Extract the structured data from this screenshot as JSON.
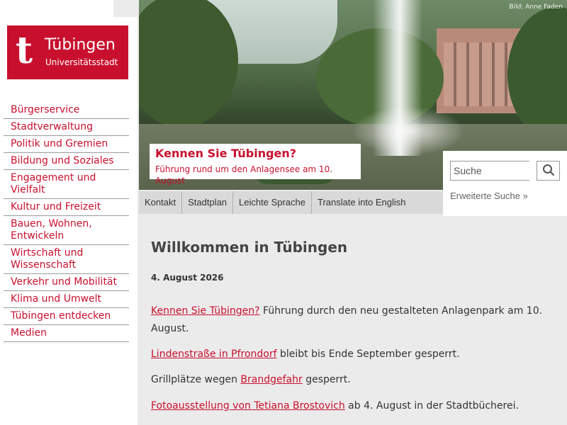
{
  "logo": {
    "mark": "t",
    "name": "Tübingen",
    "sub": "Universitätsstadt"
  },
  "nav": [
    "Bürgerservice",
    "Stadtverwaltung",
    "Politik und Gremien",
    "Bildung und Soziales",
    "Engagement und Vielfalt",
    "Kultur und Freizeit",
    "Bauen, Wohnen, Entwickeln",
    "Wirtschaft und Wissenschaft",
    "Verkehr und Mobilität",
    "Klima und Umwelt",
    "Tübingen entdecken",
    "Medien"
  ],
  "hero": {
    "credit": "Bild: Anne Faden",
    "caption_title": "Kennen Sie Tübingen?",
    "caption_sub": "Führung rund um den Anlagensee am 10. August"
  },
  "search": {
    "placeholder": "Suche",
    "button_icon": "magnifier-icon",
    "advanced": "Erweiterte Suche »"
  },
  "servicebar": [
    "Kontakt",
    "Stadtplan",
    "Leichte Sprache",
    "Translate into English"
  ],
  "main": {
    "title": "Willkommen in Tübingen",
    "date": "4. August 2026",
    "news": [
      {
        "link": "Kennen Sie Tübingen?",
        "before": "",
        "after": " Führung durch den neu gestalteten Anlagenpark am 10. August."
      },
      {
        "link": "Lindenstraße in Pfrondorf",
        "before": "",
        "after": " bleibt bis Ende September gesperrt."
      },
      {
        "link": "Brandgefahr",
        "before": "Grillplätze wegen ",
        "after": " gesperrt."
      },
      {
        "link": "Fotoausstellung von Tetiana Brostovich",
        "before": "",
        "after": " ab 4. August in der Stadtbücherei."
      }
    ]
  },
  "colors": {
    "brand": "#c8102e",
    "background": "#ebebeb"
  }
}
